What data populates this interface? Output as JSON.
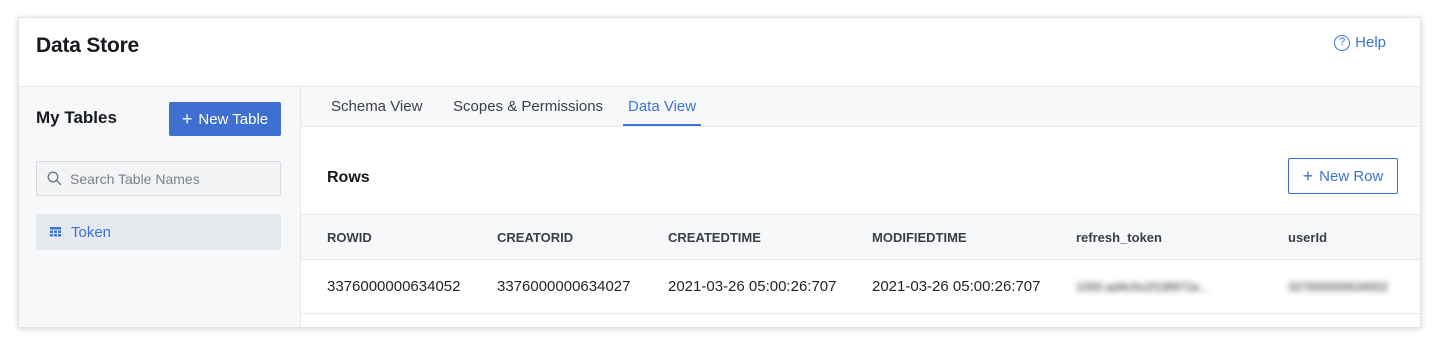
{
  "header": {
    "title": "Data Store",
    "help_label": "Help",
    "help_icon": "question-circle-icon"
  },
  "sidebar": {
    "title": "My Tables",
    "new_table_label": "New Table",
    "search_placeholder": "Search Table Names",
    "tables": [
      {
        "label": "Token",
        "icon": "table-grid-icon",
        "selected": true
      }
    ]
  },
  "tabs": [
    {
      "label": "Schema View",
      "active": false
    },
    {
      "label": "Scopes & Permissions",
      "active": false
    },
    {
      "label": "Data View",
      "active": true
    }
  ],
  "rows_section": {
    "title": "Rows",
    "new_row_label": "New Row",
    "columns": [
      "ROWID",
      "CREATORID",
      "CREATEDTIME",
      "MODIFIEDTIME",
      "refresh_token",
      "userId"
    ],
    "rows": [
      {
        "ROWID": "3376000000634052",
        "CREATORID": "3376000000634027",
        "CREATEDTIME": "2021-03-26 05:00:26:707",
        "MODIFIEDTIME": "2021-03-26 05:00:26:707",
        "refresh_token": "1000.ad4c5e2f18f972a...",
        "userId": "337600000634002"
      }
    ]
  },
  "colors": {
    "accent": "#3b73d6",
    "button_primary": "#3f6fd0",
    "panel_bg": "#f7f8fa"
  }
}
